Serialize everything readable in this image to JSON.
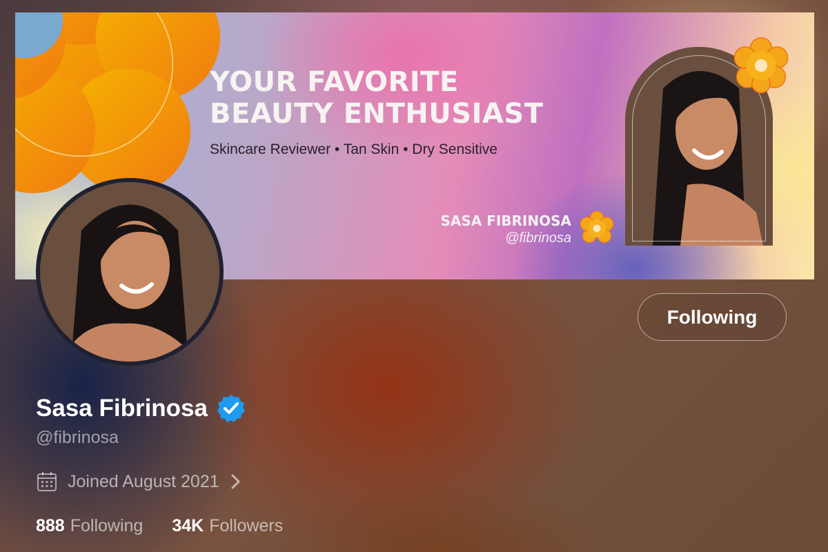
{
  "banner": {
    "headline_line1": "YOUR FAVORITE",
    "headline_line2": "BEAUTY ENTHUSIAST",
    "tagline": "Skincare Reviewer • Tan Skin • Dry Sensitive",
    "name": "SASA FIBRINOSA",
    "handle": "@fibrinosa"
  },
  "actions": {
    "follow_label": "Following"
  },
  "profile": {
    "display_name": "Sasa Fibrinosa",
    "handle": "@fibrinosa",
    "verified_icon": "verified-badge-icon",
    "joined": "Joined August 2021"
  },
  "stats": {
    "following_count": "888",
    "following_label": "Following",
    "followers_count": "34K",
    "followers_label": "Followers"
  },
  "colors": {
    "accent_orange": "#f39a12",
    "verified_blue": "#1d9bf0",
    "avatar_bg": "#6a4f3e"
  }
}
